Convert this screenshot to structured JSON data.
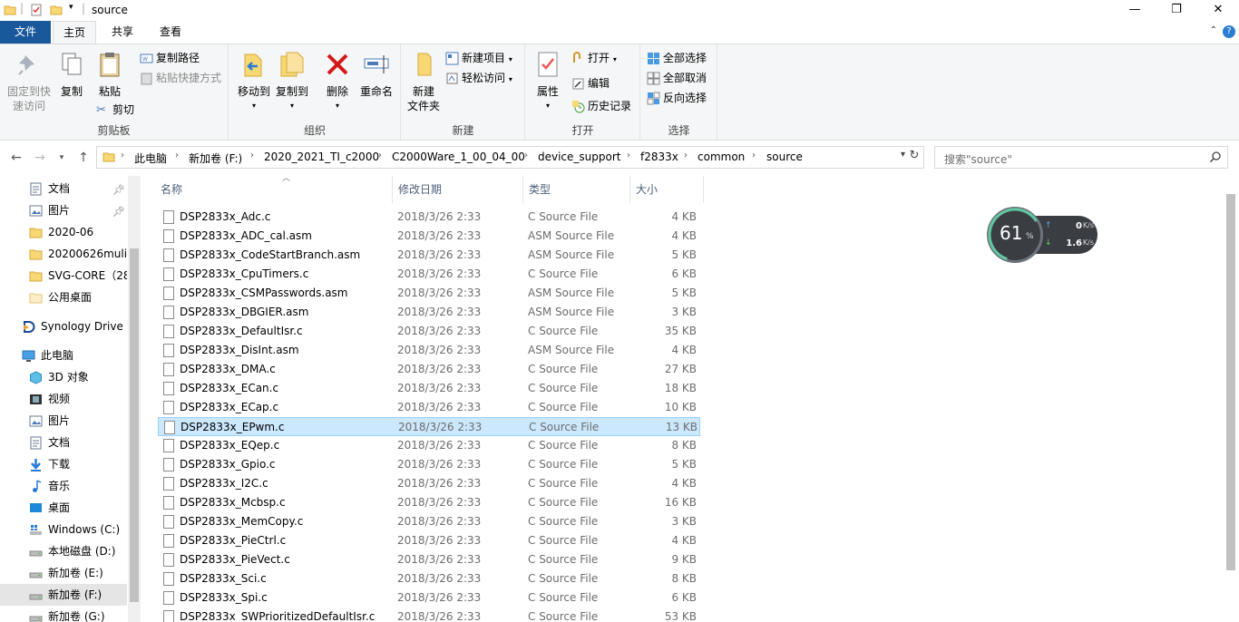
{
  "window": {
    "title": "source",
    "controls": {
      "minimize": "—",
      "maximize": "❐",
      "close": "✕"
    }
  },
  "tabs": {
    "file": "文件",
    "home": "主页",
    "share": "共享",
    "view": "查看"
  },
  "ribbon": {
    "clipboard": {
      "pin_label_1": "固定到快",
      "pin_label_2": "速访问",
      "copy": "复制",
      "paste": "粘贴",
      "copy_path": "复制路径",
      "paste_shortcut": "粘贴快捷方式",
      "cut": "剪切",
      "group": "剪贴板"
    },
    "organize": {
      "move_to": "移动到",
      "copy_to": "复制到",
      "delete": "删除",
      "rename": "重命名",
      "group": "组织"
    },
    "new": {
      "new_folder_1": "新建",
      "new_folder_2": "文件夹",
      "new_item": "新建项目",
      "easy_access": "轻松访问",
      "group": "新建"
    },
    "open": {
      "properties": "属性",
      "open": "打开",
      "edit": "编辑",
      "history": "历史记录",
      "group": "打开"
    },
    "select": {
      "select_all": "全部选择",
      "select_none": "全部取消",
      "invert": "反向选择",
      "group": "选择"
    }
  },
  "address": {
    "crumbs": [
      "此电脑",
      "新加卷 (F:)",
      "2020_2021_TI_c2000",
      "C2000Ware_1_00_04_00",
      "device_support",
      "f2833x",
      "common",
      "source"
    ],
    "search_placeholder": "搜索\"source\""
  },
  "nav": [
    {
      "label": "文档",
      "icon": "documents-icon",
      "pinned": true
    },
    {
      "label": "图片",
      "icon": "pictures-icon",
      "pinned": true
    },
    {
      "label": "2020-06",
      "icon": "folder-icon"
    },
    {
      "label": "20200626mulitsim",
      "icon": "folder-icon"
    },
    {
      "label": "SVG-CORE（28",
      "icon": "folder-icon"
    },
    {
      "label": "公用桌面",
      "icon": "folder-light-icon"
    },
    {
      "label": "Synology Drive - ",
      "icon": "synology-drive-icon"
    },
    {
      "label": "此电脑",
      "icon": "this-pc-icon"
    },
    {
      "label": "3D 对象",
      "icon": "3d-objects-icon"
    },
    {
      "label": "视频",
      "icon": "videos-icon"
    },
    {
      "label": "图片",
      "icon": "pictures-icon"
    },
    {
      "label": "文档",
      "icon": "documents-icon"
    },
    {
      "label": "下载",
      "icon": "downloads-icon"
    },
    {
      "label": "音乐",
      "icon": "music-icon"
    },
    {
      "label": "桌面",
      "icon": "desktop-icon"
    },
    {
      "label": "Windows (C:)",
      "icon": "windows-drive-icon"
    },
    {
      "label": "本地磁盘 (D:)",
      "icon": "drive-icon"
    },
    {
      "label": "新加卷 (E:)",
      "icon": "drive-icon"
    },
    {
      "label": "新加卷 (F:)",
      "icon": "drive-icon",
      "selected": true
    },
    {
      "label": "新加卷 (G:)",
      "icon": "drive-icon"
    }
  ],
  "columns": {
    "name": "名称",
    "modified": "修改日期",
    "type": "类型",
    "size": "大小"
  },
  "files": [
    {
      "name": "DSP2833x_Adc.c",
      "date": "2018/3/26 2:33",
      "type": "C Source File",
      "size": "4 KB"
    },
    {
      "name": "DSP2833x_ADC_cal.asm",
      "date": "2018/3/26 2:33",
      "type": "ASM Source File",
      "size": "4 KB"
    },
    {
      "name": "DSP2833x_CodeStartBranch.asm",
      "date": "2018/3/26 2:33",
      "type": "ASM Source File",
      "size": "5 KB"
    },
    {
      "name": "DSP2833x_CpuTimers.c",
      "date": "2018/3/26 2:33",
      "type": "C Source File",
      "size": "6 KB"
    },
    {
      "name": "DSP2833x_CSMPasswords.asm",
      "date": "2018/3/26 2:33",
      "type": "ASM Source File",
      "size": "5 KB"
    },
    {
      "name": "DSP2833x_DBGIER.asm",
      "date": "2018/3/26 2:33",
      "type": "ASM Source File",
      "size": "3 KB"
    },
    {
      "name": "DSP2833x_DefaultIsr.c",
      "date": "2018/3/26 2:33",
      "type": "C Source File",
      "size": "35 KB"
    },
    {
      "name": "DSP2833x_DisInt.asm",
      "date": "2018/3/26 2:33",
      "type": "ASM Source File",
      "size": "4 KB"
    },
    {
      "name": "DSP2833x_DMA.c",
      "date": "2018/3/26 2:33",
      "type": "C Source File",
      "size": "27 KB"
    },
    {
      "name": "DSP2833x_ECan.c",
      "date": "2018/3/26 2:33",
      "type": "C Source File",
      "size": "18 KB"
    },
    {
      "name": "DSP2833x_ECap.c",
      "date": "2018/3/26 2:33",
      "type": "C Source File",
      "size": "10 KB"
    },
    {
      "name": "DSP2833x_EPwm.c",
      "date": "2018/3/26 2:33",
      "type": "C Source File",
      "size": "13 KB",
      "selected": true
    },
    {
      "name": "DSP2833x_EQep.c",
      "date": "2018/3/26 2:33",
      "type": "C Source File",
      "size": "8 KB"
    },
    {
      "name": "DSP2833x_Gpio.c",
      "date": "2018/3/26 2:33",
      "type": "C Source File",
      "size": "5 KB"
    },
    {
      "name": "DSP2833x_I2C.c",
      "date": "2018/3/26 2:33",
      "type": "C Source File",
      "size": "4 KB"
    },
    {
      "name": "DSP2833x_Mcbsp.c",
      "date": "2018/3/26 2:33",
      "type": "C Source File",
      "size": "16 KB"
    },
    {
      "name": "DSP2833x_MemCopy.c",
      "date": "2018/3/26 2:33",
      "type": "C Source File",
      "size": "3 KB"
    },
    {
      "name": "DSP2833x_PieCtrl.c",
      "date": "2018/3/26 2:33",
      "type": "C Source File",
      "size": "4 KB"
    },
    {
      "name": "DSP2833x_PieVect.c",
      "date": "2018/3/26 2:33",
      "type": "C Source File",
      "size": "9 KB"
    },
    {
      "name": "DSP2833x_Sci.c",
      "date": "2018/3/26 2:33",
      "type": "C Source File",
      "size": "8 KB"
    },
    {
      "name": "DSP2833x_Spi.c",
      "date": "2018/3/26 2:33",
      "type": "C Source File",
      "size": "6 KB"
    },
    {
      "name": "DSP2833x_SWPrioritizedDefaultIsr.c",
      "date": "2018/3/26 2:33",
      "type": "C Source File",
      "size": "53 KB"
    }
  ],
  "netmonitor": {
    "percent": "61",
    "percent_sign": "%",
    "upload_value": "0",
    "download_value": "1.6",
    "unit": "K/s",
    "level_fraction": 0.61
  },
  "colors": {
    "accent": "#19589b",
    "selection": "#cce8ff",
    "selection_border": "#99d1ff",
    "folder": "#f8d775"
  }
}
